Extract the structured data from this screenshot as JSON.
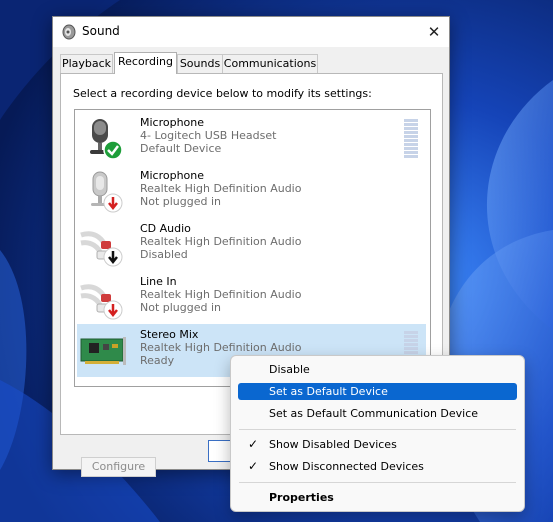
{
  "window": {
    "title": "Sound",
    "close_glyph": "✕"
  },
  "tabs": [
    {
      "label": "Playback"
    },
    {
      "label": "Recording"
    },
    {
      "label": "Sounds"
    },
    {
      "label": "Communications"
    }
  ],
  "active_tab": "Recording",
  "instruction": "Select a recording device below to modify its settings:",
  "devices": [
    {
      "name": "Microphone",
      "desc": "4- Logitech USB Headset",
      "status": "Default Device",
      "icon": "headset-microphone-icon",
      "badge": "green-check-badge"
    },
    {
      "name": "Microphone",
      "desc": "Realtek High Definition Audio",
      "status": "Not plugged in",
      "icon": "microphone-icon",
      "badge": "red-down-arrow-badge"
    },
    {
      "name": "CD Audio",
      "desc": "Realtek High Definition Audio",
      "status": "Disabled",
      "icon": "rca-cable-icon",
      "badge": "black-down-arrow-badge"
    },
    {
      "name": "Line In",
      "desc": "Realtek High Definition Audio",
      "status": "Not plugged in",
      "icon": "rca-cable-icon",
      "badge": "red-down-arrow-badge"
    },
    {
      "name": "Stereo Mix",
      "desc": "Realtek High Definition Audio",
      "status": "Ready",
      "icon": "sound-card-icon",
      "badge": ""
    }
  ],
  "buttons": {
    "configure": "Configure"
  },
  "context_menu": {
    "items": [
      {
        "label": "Disable"
      },
      {
        "label": "Set as Default Device",
        "highlighted": true
      },
      {
        "label": "Set as Default Communication Device"
      },
      {
        "label": "Show Disabled Devices",
        "checked": true
      },
      {
        "label": "Show Disconnected Devices",
        "checked": true
      },
      {
        "label": "Properties",
        "bold": true
      }
    ]
  },
  "colors": {
    "accent": "#0a67d0",
    "selection": "#cce4f7",
    "default_badge": "#1e9e3a",
    "unplugged_badge": "#d42020"
  }
}
